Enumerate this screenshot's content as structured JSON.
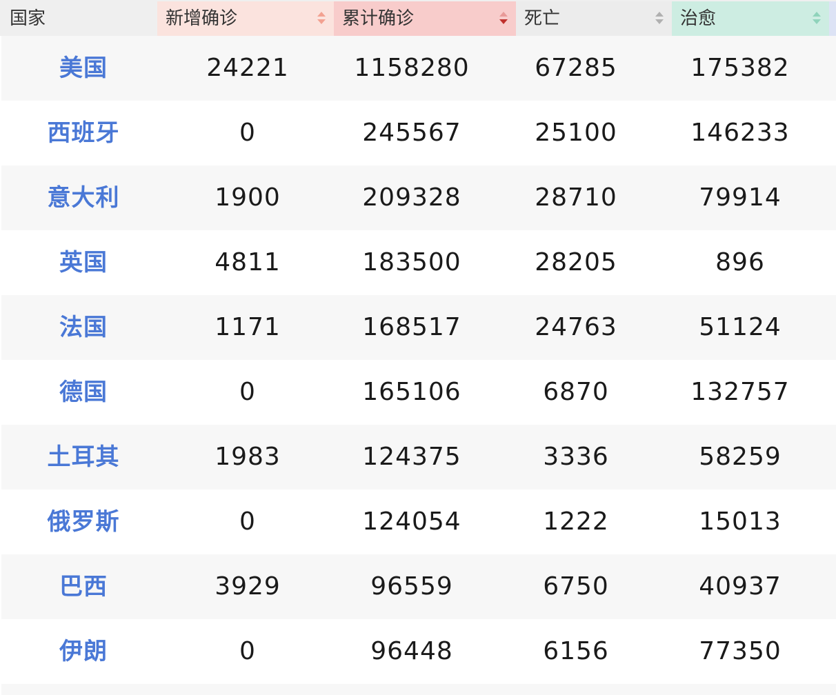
{
  "header": {
    "country": "国家",
    "new_confirmed": "新增确诊",
    "total_confirmed": "累计确诊",
    "deaths": "死亡",
    "cured": "治愈"
  },
  "colors": {
    "country_link": "#4a78d6",
    "new_header_bg": "#fbe3de",
    "total_header_bg": "#f8cccb",
    "death_header_bg": "#ececec",
    "cured_header_bg": "#cdede2",
    "active_sort_arrow": "#c0302c"
  },
  "sort": {
    "active_column": "total_confirmed",
    "direction": "descending"
  },
  "rows": [
    {
      "country": "美国",
      "new": "24221",
      "total": "1158280",
      "deaths": "67285",
      "cured": "175382"
    },
    {
      "country": "西班牙",
      "new": "0",
      "total": "245567",
      "deaths": "25100",
      "cured": "146233"
    },
    {
      "country": "意大利",
      "new": "1900",
      "total": "209328",
      "deaths": "28710",
      "cured": "79914"
    },
    {
      "country": "英国",
      "new": "4811",
      "total": "183500",
      "deaths": "28205",
      "cured": "896"
    },
    {
      "country": "法国",
      "new": "1171",
      "total": "168517",
      "deaths": "24763",
      "cured": "51124"
    },
    {
      "country": "德国",
      "new": "0",
      "total": "165106",
      "deaths": "6870",
      "cured": "132757"
    },
    {
      "country": "土耳其",
      "new": "1983",
      "total": "124375",
      "deaths": "3336",
      "cured": "58259"
    },
    {
      "country": "俄罗斯",
      "new": "0",
      "total": "124054",
      "deaths": "1222",
      "cured": "15013"
    },
    {
      "country": "巴西",
      "new": "3929",
      "total": "96559",
      "deaths": "6750",
      "cured": "40937"
    },
    {
      "country": "伊朗",
      "new": "0",
      "total": "96448",
      "deaths": "6156",
      "cured": "77350"
    }
  ]
}
